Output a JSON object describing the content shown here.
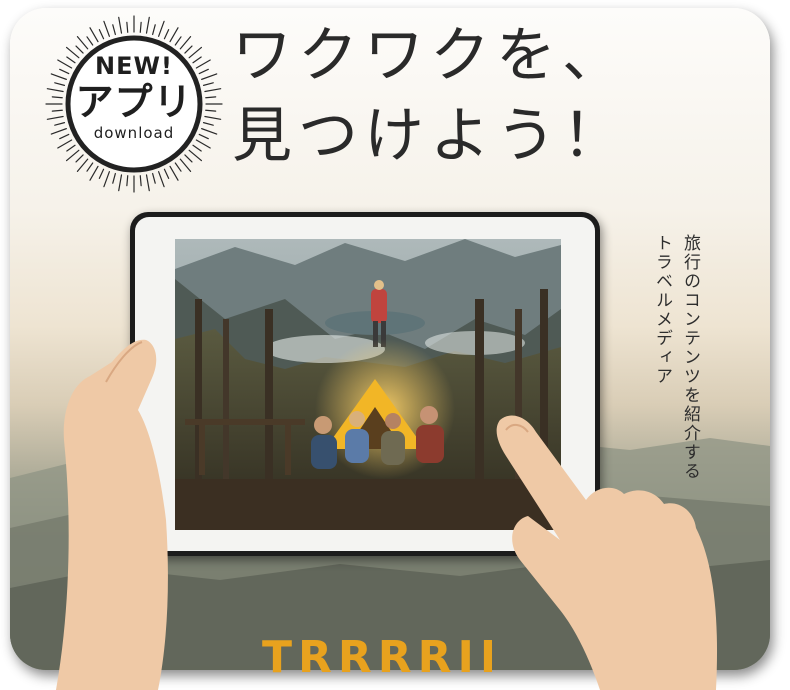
{
  "badge": {
    "line1": "NEW!",
    "line2": "アプリ",
    "line3": "download"
  },
  "headline": {
    "line1": "ワクワクを、",
    "line2": "見つけよう！"
  },
  "vertical_copy": {
    "line1": "旅行のコンテンツを紹介する",
    "line2": "トラベルメディア"
  },
  "brand": {
    "name": "TRRRRIP"
  },
  "colors": {
    "accent": "#e8a21e",
    "text": "#2a2a2a"
  },
  "icons": {
    "badge": "sunburst-badge-icon"
  }
}
